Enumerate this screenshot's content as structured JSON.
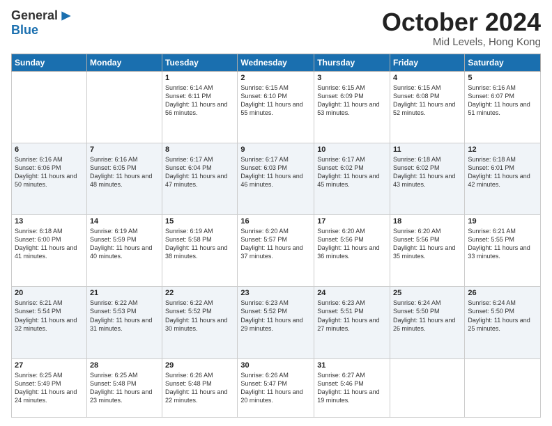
{
  "header": {
    "logo_general": "General",
    "logo_blue": "Blue",
    "month_title": "October 2024",
    "location": "Mid Levels, Hong Kong"
  },
  "days_of_week": [
    "Sunday",
    "Monday",
    "Tuesday",
    "Wednesday",
    "Thursday",
    "Friday",
    "Saturday"
  ],
  "weeks": [
    [
      {
        "day": "",
        "info": ""
      },
      {
        "day": "",
        "info": ""
      },
      {
        "day": "1",
        "info": "Sunrise: 6:14 AM\nSunset: 6:11 PM\nDaylight: 11 hours and 56 minutes."
      },
      {
        "day": "2",
        "info": "Sunrise: 6:15 AM\nSunset: 6:10 PM\nDaylight: 11 hours and 55 minutes."
      },
      {
        "day": "3",
        "info": "Sunrise: 6:15 AM\nSunset: 6:09 PM\nDaylight: 11 hours and 53 minutes."
      },
      {
        "day": "4",
        "info": "Sunrise: 6:15 AM\nSunset: 6:08 PM\nDaylight: 11 hours and 52 minutes."
      },
      {
        "day": "5",
        "info": "Sunrise: 6:16 AM\nSunset: 6:07 PM\nDaylight: 11 hours and 51 minutes."
      }
    ],
    [
      {
        "day": "6",
        "info": "Sunrise: 6:16 AM\nSunset: 6:06 PM\nDaylight: 11 hours and 50 minutes."
      },
      {
        "day": "7",
        "info": "Sunrise: 6:16 AM\nSunset: 6:05 PM\nDaylight: 11 hours and 48 minutes."
      },
      {
        "day": "8",
        "info": "Sunrise: 6:17 AM\nSunset: 6:04 PM\nDaylight: 11 hours and 47 minutes."
      },
      {
        "day": "9",
        "info": "Sunrise: 6:17 AM\nSunset: 6:03 PM\nDaylight: 11 hours and 46 minutes."
      },
      {
        "day": "10",
        "info": "Sunrise: 6:17 AM\nSunset: 6:02 PM\nDaylight: 11 hours and 45 minutes."
      },
      {
        "day": "11",
        "info": "Sunrise: 6:18 AM\nSunset: 6:02 PM\nDaylight: 11 hours and 43 minutes."
      },
      {
        "day": "12",
        "info": "Sunrise: 6:18 AM\nSunset: 6:01 PM\nDaylight: 11 hours and 42 minutes."
      }
    ],
    [
      {
        "day": "13",
        "info": "Sunrise: 6:18 AM\nSunset: 6:00 PM\nDaylight: 11 hours and 41 minutes."
      },
      {
        "day": "14",
        "info": "Sunrise: 6:19 AM\nSunset: 5:59 PM\nDaylight: 11 hours and 40 minutes."
      },
      {
        "day": "15",
        "info": "Sunrise: 6:19 AM\nSunset: 5:58 PM\nDaylight: 11 hours and 38 minutes."
      },
      {
        "day": "16",
        "info": "Sunrise: 6:20 AM\nSunset: 5:57 PM\nDaylight: 11 hours and 37 minutes."
      },
      {
        "day": "17",
        "info": "Sunrise: 6:20 AM\nSunset: 5:56 PM\nDaylight: 11 hours and 36 minutes."
      },
      {
        "day": "18",
        "info": "Sunrise: 6:20 AM\nSunset: 5:56 PM\nDaylight: 11 hours and 35 minutes."
      },
      {
        "day": "19",
        "info": "Sunrise: 6:21 AM\nSunset: 5:55 PM\nDaylight: 11 hours and 33 minutes."
      }
    ],
    [
      {
        "day": "20",
        "info": "Sunrise: 6:21 AM\nSunset: 5:54 PM\nDaylight: 11 hours and 32 minutes."
      },
      {
        "day": "21",
        "info": "Sunrise: 6:22 AM\nSunset: 5:53 PM\nDaylight: 11 hours and 31 minutes."
      },
      {
        "day": "22",
        "info": "Sunrise: 6:22 AM\nSunset: 5:52 PM\nDaylight: 11 hours and 30 minutes."
      },
      {
        "day": "23",
        "info": "Sunrise: 6:23 AM\nSunset: 5:52 PM\nDaylight: 11 hours and 29 minutes."
      },
      {
        "day": "24",
        "info": "Sunrise: 6:23 AM\nSunset: 5:51 PM\nDaylight: 11 hours and 27 minutes."
      },
      {
        "day": "25",
        "info": "Sunrise: 6:24 AM\nSunset: 5:50 PM\nDaylight: 11 hours and 26 minutes."
      },
      {
        "day": "26",
        "info": "Sunrise: 6:24 AM\nSunset: 5:50 PM\nDaylight: 11 hours and 25 minutes."
      }
    ],
    [
      {
        "day": "27",
        "info": "Sunrise: 6:25 AM\nSunset: 5:49 PM\nDaylight: 11 hours and 24 minutes."
      },
      {
        "day": "28",
        "info": "Sunrise: 6:25 AM\nSunset: 5:48 PM\nDaylight: 11 hours and 23 minutes."
      },
      {
        "day": "29",
        "info": "Sunrise: 6:26 AM\nSunset: 5:48 PM\nDaylight: 11 hours and 22 minutes."
      },
      {
        "day": "30",
        "info": "Sunrise: 6:26 AM\nSunset: 5:47 PM\nDaylight: 11 hours and 20 minutes."
      },
      {
        "day": "31",
        "info": "Sunrise: 6:27 AM\nSunset: 5:46 PM\nDaylight: 11 hours and 19 minutes."
      },
      {
        "day": "",
        "info": ""
      },
      {
        "day": "",
        "info": ""
      }
    ]
  ]
}
